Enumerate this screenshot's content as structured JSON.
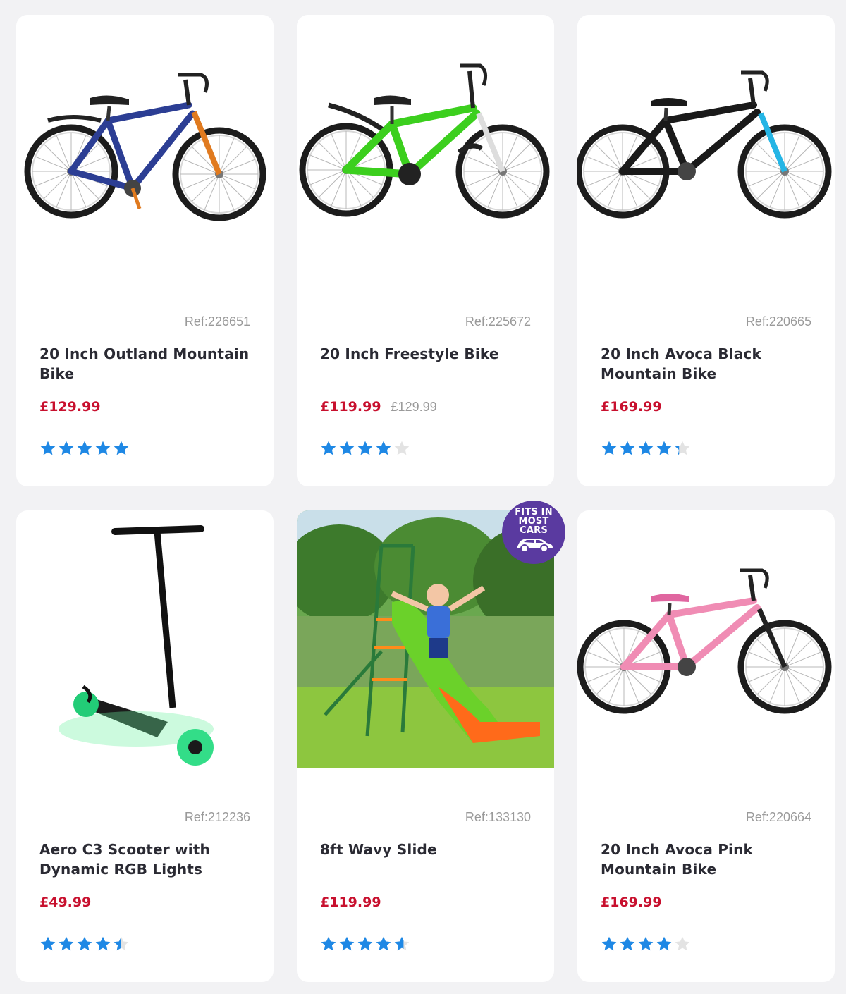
{
  "products": [
    {
      "ref": "Ref:226651",
      "title": "20 Inch Outland Mountain Bike",
      "price": "£129.99",
      "was_price": "",
      "rating": 5,
      "image": "blue-orange-kids-bike"
    },
    {
      "ref": "Ref:225672",
      "title": "20 Inch Freestyle Bike",
      "price": "£119.99",
      "was_price": "£129.99",
      "rating": 4,
      "image": "green-freestyle-bike"
    },
    {
      "ref": "Ref:220665",
      "title": "20 Inch Avoca Black Mountain Bike",
      "price": "£169.99",
      "was_price": "",
      "rating": 4.3,
      "image": "black-blue-mountain-bike"
    },
    {
      "ref": "Ref:212236",
      "title": "Aero C3 Scooter with Dynamic RGB Lights",
      "price": "£49.99",
      "was_price": "",
      "rating": 4.5,
      "image": "black-scooter-rgb-wheels"
    },
    {
      "ref": "Ref:133130",
      "title": "8ft Wavy Slide",
      "price": "£119.99",
      "was_price": "",
      "rating": 4.6,
      "image": "garden-wavy-slide-photo",
      "badge": [
        "FITS IN",
        "MOST",
        "CARS"
      ]
    },
    {
      "ref": "Ref:220664",
      "title": "20 Inch Avoca Pink Mountain Bike",
      "price": "£169.99",
      "was_price": "",
      "rating": 4,
      "image": "pink-mountain-bike"
    }
  ],
  "colors": {
    "price": "#c8102e",
    "star_filled": "#1e88e5",
    "star_empty": "#e3e3e3",
    "badge": "#5a3aa0",
    "page_background": "#f2f2f4"
  }
}
